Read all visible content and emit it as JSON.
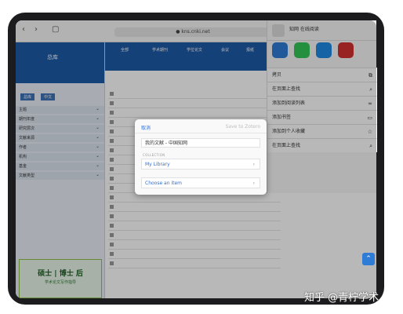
{
  "browser": {
    "url": "● kns.cnki.net"
  },
  "share_sheet": {
    "profile_name": "知网 在线阅读",
    "menu": [
      {
        "label": "拷贝",
        "icon": "copy-icon"
      },
      {
        "label": "在页面上查找",
        "icon": "search-icon"
      },
      {
        "label": "添加到阅读列表",
        "icon": "glasses-icon"
      },
      {
        "label": "添加书签",
        "icon": "book-icon"
      },
      {
        "label": "添加到个人收藏",
        "icon": "star-icon"
      },
      {
        "label": "在页面上查找",
        "icon": "search-icon"
      }
    ]
  },
  "dialog": {
    "cancel": "取消",
    "save": "Save to Zotero",
    "field_value": "我的文献 - 中国知网",
    "collection_label": "COLLECTION",
    "collection_value": "My Library",
    "tags_label": "",
    "item_value": "Choose an item"
  },
  "watermark": "知乎 @青柠学术",
  "sidebar": {
    "title": "总库",
    "sections": [
      "主题",
      "期刊年度",
      "研究层次",
      "文献来源",
      "作者",
      "机构",
      "基金",
      "文献类型"
    ],
    "ad_line1": "硕士 | 博士 后",
    "ad_line2": "学术论文写作指导"
  },
  "colors": {
    "accent": "#1e5aa8",
    "link": "#2f6fd6"
  }
}
